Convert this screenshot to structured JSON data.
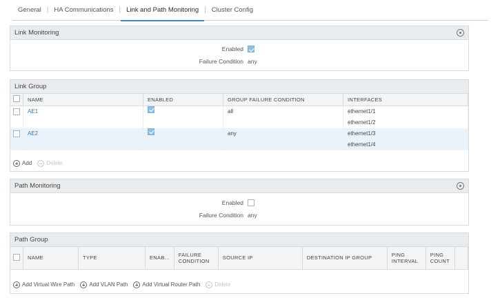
{
  "tabs": [
    {
      "label": "General"
    },
    {
      "label": "HA Communications"
    },
    {
      "label": "Link and Path Monitoring",
      "active": true
    },
    {
      "label": "Cluster Config"
    }
  ],
  "link_monitoring": {
    "title": "Link Monitoring",
    "enabled_label": "Enabled",
    "failure_label": "Failure Condition",
    "failure_value": "any"
  },
  "link_group": {
    "title": "Link Group",
    "columns": [
      "NAME",
      "ENABLED",
      "GROUP FAILURE CONDITION",
      "INTERFACES"
    ],
    "rows": [
      {
        "name": "AE1",
        "condition": "all",
        "interfaces": [
          "ethernet1/1",
          "ethernet1/2"
        ]
      },
      {
        "name": "AE2",
        "condition": "any",
        "interfaces": [
          "ethernet1/3",
          "ethernet1/4"
        ]
      }
    ],
    "add_label": "Add",
    "delete_label": "Delete"
  },
  "path_monitoring": {
    "title": "Path Monitoring",
    "enabled_label": "Enabled",
    "failure_label": "Failure Condition",
    "failure_value": "any"
  },
  "path_group": {
    "title": "Path Group",
    "columns": [
      "NAME",
      "TYPE",
      "ENAB...",
      "FAILURE CONDITION",
      "SOURCE IP",
      "DESTINATION IP GROUP",
      "PING INTERVAL",
      "PING COUNT"
    ],
    "add_wire": "Add Virtual Wire Path",
    "add_vlan": "Add VLAN Path",
    "add_router": "Add Virtual Router Path",
    "delete_label": "Delete"
  }
}
